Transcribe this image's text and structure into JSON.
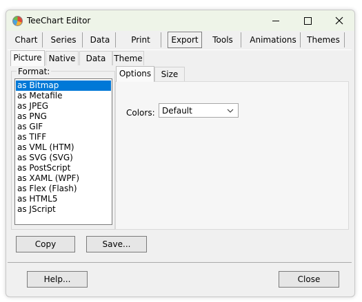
{
  "window": {
    "title": "TeeChart Editor",
    "controls": {
      "minimize": "minimize",
      "maximize": "maximize",
      "close": "close"
    }
  },
  "top_tabs": [
    {
      "label": "Chart",
      "selected": false
    },
    {
      "label": "Series",
      "selected": false
    },
    {
      "label": "Data",
      "selected": false
    },
    {
      "label": "Print",
      "selected": false
    },
    {
      "label": "Export",
      "selected": true
    },
    {
      "label": "Tools",
      "selected": false
    },
    {
      "label": "Animations",
      "selected": false
    },
    {
      "label": "Themes",
      "selected": false
    }
  ],
  "sub_tabs": [
    {
      "label": "Picture",
      "selected": true
    },
    {
      "label": "Native",
      "selected": false
    },
    {
      "label": "Data",
      "selected": false
    },
    {
      "label": "Theme",
      "selected": false
    }
  ],
  "format": {
    "legend": "Format:",
    "items": [
      "as Bitmap",
      "as Metafile",
      "as JPEG",
      "as PNG",
      "as GIF",
      "as TIFF",
      "as VML (HTM)",
      "as SVG (SVG)",
      "as PostScript",
      "as XAML (WPF)",
      "as Flex (Flash)",
      "as HTML5",
      "as JScript"
    ],
    "selected_index": 0
  },
  "options_tabs": [
    {
      "label": "Options",
      "selected": true
    },
    {
      "label": "Size",
      "selected": false
    }
  ],
  "colors": {
    "label": "Colors:",
    "value": "Default"
  },
  "buttons": {
    "copy": "Copy",
    "save": "Save...",
    "help": "Help...",
    "close": "Close"
  },
  "colors_palette": {
    "selection": "#0078d7",
    "window_bg": "#f0f0f0",
    "title_bg": "#eef4e8"
  }
}
